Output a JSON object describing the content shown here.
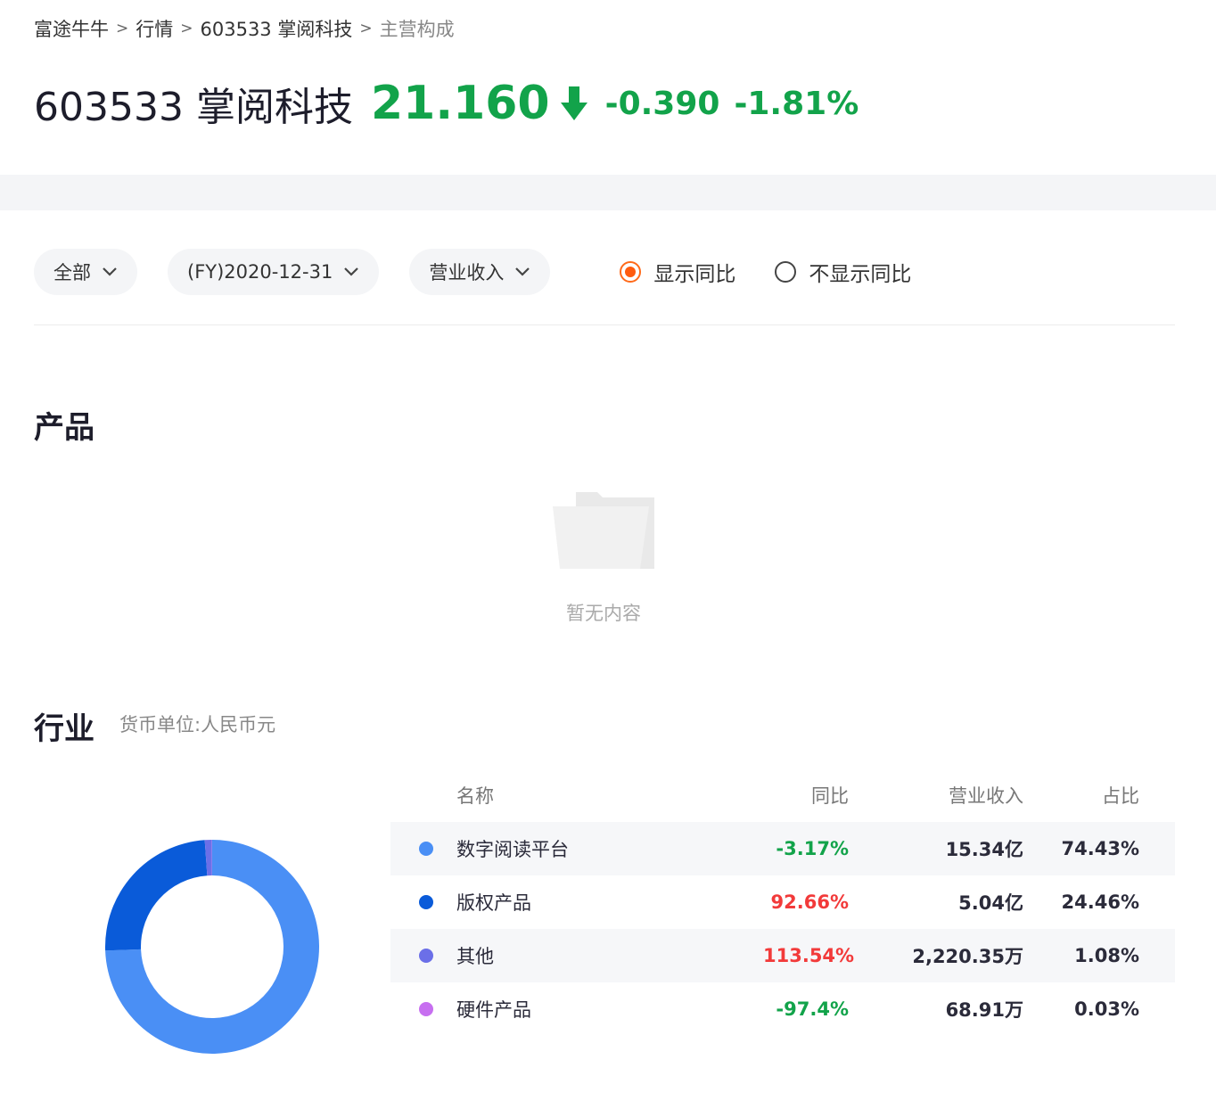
{
  "breadcrumb": {
    "items": [
      "富途牛牛",
      "行情",
      "603533 掌阅科技"
    ],
    "current": "主营构成",
    "separator": ">"
  },
  "quote": {
    "name": "603533 掌阅科技",
    "price": "21.160",
    "change": "-0.390",
    "change_pct": "-1.81%",
    "trend_icon": "arrow-down-icon",
    "color": "#12a34a"
  },
  "filters": {
    "scope": "全部",
    "period": "(FY)2020-12-31",
    "metric": "营业收入",
    "show_yoy_label": "显示同比",
    "hide_yoy_label": "不显示同比",
    "selected": "show_yoy"
  },
  "product_section": {
    "title": "产品",
    "empty_text": "暂无内容"
  },
  "industry_section": {
    "title": "行业",
    "currency_note": "货币单位:人民币元",
    "headers": {
      "name": "名称",
      "yoy": "同比",
      "revenue": "营业收入",
      "share": "占比"
    },
    "rows": [
      {
        "name": "数字阅读平台",
        "yoy": "-3.17%",
        "revenue": "15.34亿",
        "share": "74.43%",
        "color": "#4a8ff5",
        "trend": "neg"
      },
      {
        "name": "版权产品",
        "yoy": "92.66%",
        "revenue": "5.04亿",
        "share": "24.46%",
        "color": "#0a5bd9",
        "trend": "pos"
      },
      {
        "name": "其他",
        "yoy": "113.54%",
        "revenue": "2,220.35万",
        "share": "1.08%",
        "color": "#6b6fe8",
        "trend": "pos"
      },
      {
        "name": "硬件产品",
        "yoy": "-97.4%",
        "revenue": "68.91万",
        "share": "0.03%",
        "color": "#c76ff0",
        "trend": "neg"
      }
    ]
  },
  "chart_data": {
    "type": "pie",
    "labels": [
      "数字阅读平台",
      "版权产品",
      "其他",
      "硬件产品"
    ],
    "values": [
      74.43,
      24.46,
      1.08,
      0.03
    ],
    "colors": [
      "#4a8ff5",
      "#0a5bd9",
      "#6b6fe8",
      "#c76ff0"
    ]
  }
}
